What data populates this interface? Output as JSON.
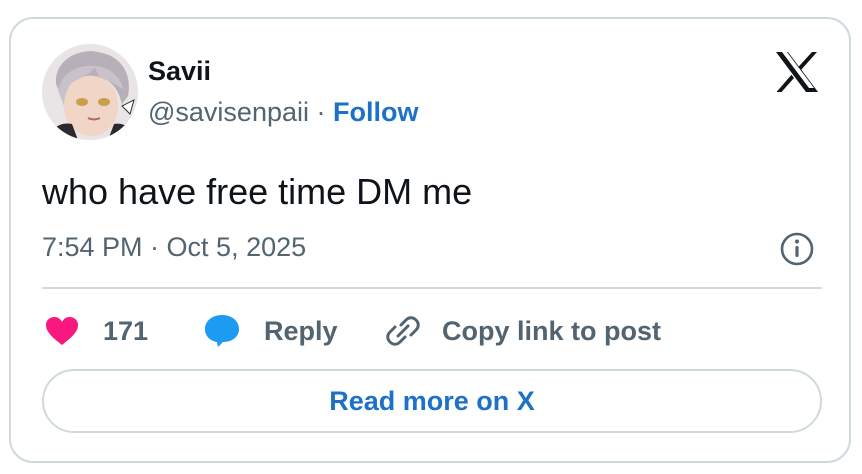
{
  "author": {
    "display_name": "Savii",
    "handle": "@savisenpaii",
    "separator": "·",
    "follow_label": "Follow"
  },
  "tweet": {
    "text": "who have free time DM me",
    "timestamp": "7:54 PM · Oct 5, 2025"
  },
  "actions": {
    "like_count": "171",
    "reply_label": "Reply",
    "copy_link_label": "Copy link to post"
  },
  "footer": {
    "read_more_label": "Read more on X"
  },
  "colors": {
    "text_primary": "#0f1419",
    "text_secondary": "#536471",
    "link_blue": "#1d72c8",
    "like_pink": "#f91880",
    "reply_blue": "#1d9bf0",
    "border": "#cfd9de"
  },
  "icons": {
    "brand": "x-logo-icon",
    "info": "info-icon",
    "like": "heart-icon",
    "reply": "speech-bubble-icon",
    "copy": "link-icon"
  }
}
